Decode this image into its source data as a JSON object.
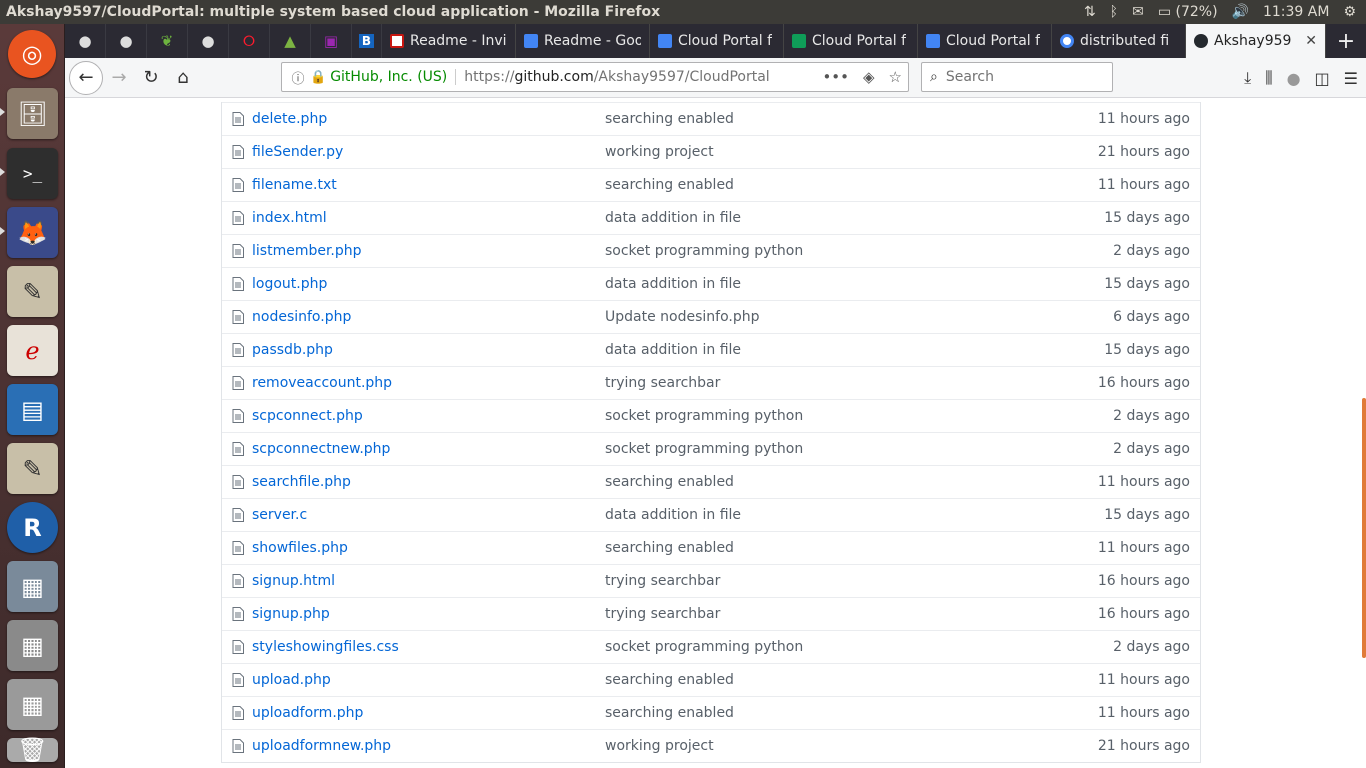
{
  "window": {
    "title": "Akshay9597/CloudPortal: multiple system based cloud application - Mozilla Firefox"
  },
  "panel": {
    "battery": "(72%)",
    "time": "11:39 AM"
  },
  "tabs": [
    {
      "label": "Readme - Invi",
      "icon_color": "#c71610",
      "icon": "gmail-icon"
    },
    {
      "label": "Readme - Goo",
      "icon_color": "#4285f4",
      "icon": "docs-icon"
    },
    {
      "label": "Cloud Portal f",
      "icon_color": "#4285f4",
      "icon": "docs-icon"
    },
    {
      "label": "Cloud Portal f",
      "icon_color": "#0f9d58",
      "icon": "sheets-icon"
    },
    {
      "label": "Cloud Portal f",
      "icon_color": "#4285f4",
      "icon": "docs-icon"
    },
    {
      "label": "distributed fi",
      "icon_color": "#4285f4",
      "icon": "google-icon"
    },
    {
      "label": "Akshay959",
      "icon_color": "#24292e",
      "icon": "github-icon",
      "active": true
    }
  ],
  "navbar": {
    "org": "GitHub, Inc. (US)",
    "url_prefix": "https://",
    "url_host": "github.com",
    "url_path": "/Akshay9597/CloudPortal",
    "search_placeholder": "Search"
  },
  "files": [
    {
      "name": "delete.php",
      "message": "searching enabled",
      "age": "11 hours ago"
    },
    {
      "name": "fileSender.py",
      "message": "working project",
      "age": "21 hours ago"
    },
    {
      "name": "filename.txt",
      "message": "searching enabled",
      "age": "11 hours ago"
    },
    {
      "name": "index.html",
      "message": "data addition in file",
      "age": "15 days ago"
    },
    {
      "name": "listmember.php",
      "message": "socket programming python",
      "age": "2 days ago"
    },
    {
      "name": "logout.php",
      "message": "data addition in file",
      "age": "15 days ago"
    },
    {
      "name": "nodesinfo.php",
      "message": "Update nodesinfo.php",
      "age": "6 days ago"
    },
    {
      "name": "passdb.php",
      "message": "data addition in file",
      "age": "15 days ago"
    },
    {
      "name": "removeaccount.php",
      "message": "trying searchbar",
      "age": "16 hours ago"
    },
    {
      "name": "scpconnect.php",
      "message": "socket programming python",
      "age": "2 days ago"
    },
    {
      "name": "scpconnectnew.php",
      "message": "socket programming python",
      "age": "2 days ago"
    },
    {
      "name": "searchfile.php",
      "message": "searching enabled",
      "age": "11 hours ago"
    },
    {
      "name": "server.c",
      "message": "data addition in file",
      "age": "15 days ago"
    },
    {
      "name": "showfiles.php",
      "message": "searching enabled",
      "age": "11 hours ago"
    },
    {
      "name": "signup.html",
      "message": "trying searchbar",
      "age": "16 hours ago"
    },
    {
      "name": "signup.php",
      "message": "trying searchbar",
      "age": "16 hours ago"
    },
    {
      "name": "styleshowingfiles.css",
      "message": "socket programming python",
      "age": "2 days ago"
    },
    {
      "name": "upload.php",
      "message": "searching enabled",
      "age": "11 hours ago"
    },
    {
      "name": "uploadform.php",
      "message": "searching enabled",
      "age": "11 hours ago"
    },
    {
      "name": "uploadformnew.php",
      "message": "working project",
      "age": "21 hours ago"
    }
  ]
}
